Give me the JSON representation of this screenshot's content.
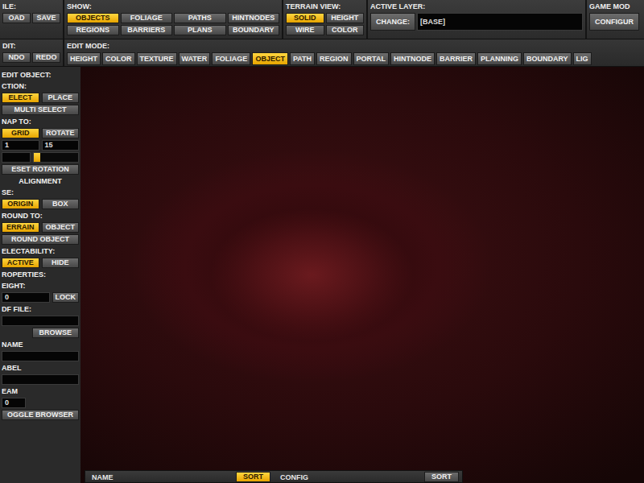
{
  "toolbar": {
    "file": {
      "label": "ILE:",
      "buttons": [
        {
          "label": "OAD",
          "selected": false
        },
        {
          "label": "SAVE",
          "selected": false
        }
      ]
    },
    "show": {
      "label": "SHOW:",
      "buttons": [
        {
          "label": "OBJECTS",
          "selected": true
        },
        {
          "label": "FOLIAGE",
          "selected": false
        },
        {
          "label": "PATHS",
          "selected": false
        },
        {
          "label": "HINTNODES",
          "selected": false
        },
        {
          "label": "REGIONS",
          "selected": false
        },
        {
          "label": "BARRIERS",
          "selected": false
        },
        {
          "label": "PLANS",
          "selected": false
        },
        {
          "label": "BOUNDARY",
          "selected": false
        }
      ]
    },
    "terrain_view": {
      "label": "TERRAIN VIEW:",
      "buttons": [
        {
          "label": "SOLID",
          "selected": true
        },
        {
          "label": "HEIGHT",
          "selected": false
        },
        {
          "label": "WIRE",
          "selected": false
        },
        {
          "label": "COLOR",
          "selected": false
        }
      ]
    },
    "active_layer": {
      "label": "ACTIVE LAYER:",
      "button": "CHANGE:",
      "value": "[BASE]"
    },
    "game_mode": {
      "label": "GAME MOD",
      "button": "CONFIGUR"
    }
  },
  "edit_bar": {
    "edit": {
      "label": "DIT:",
      "buttons": [
        {
          "label": "NDO",
          "selected": false
        },
        {
          "label": "REDO",
          "selected": false
        }
      ]
    },
    "edit_mode": {
      "label": "EDIT MODE:",
      "buttons": [
        {
          "label": "HEIGHT",
          "selected": false
        },
        {
          "label": "COLOR",
          "selected": false
        },
        {
          "label": "TEXTURE",
          "selected": false
        },
        {
          "label": "WATER",
          "selected": false
        },
        {
          "label": "FOLIAGE",
          "selected": false
        },
        {
          "label": "OBJECT",
          "selected": true
        },
        {
          "label": "PATH",
          "selected": false
        },
        {
          "label": "REGION",
          "selected": false
        },
        {
          "label": "PORTAL",
          "selected": false
        },
        {
          "label": "HINTNODE",
          "selected": false
        },
        {
          "label": "BARRIER",
          "selected": false
        },
        {
          "label": "PLANNING",
          "selected": false
        },
        {
          "label": "BOUNDARY",
          "selected": false
        },
        {
          "label": "LIG",
          "selected": false
        }
      ]
    }
  },
  "panel_rows": [
    {
      "kind": "label",
      "text": "EDIT OBJECT:"
    },
    {
      "kind": "label",
      "text": "CTION:"
    },
    {
      "kind": "buttons",
      "buttons": [
        {
          "label": "ELECT",
          "selected": true
        },
        {
          "label": "PLACE",
          "selected": false
        }
      ]
    },
    {
      "kind": "buttons",
      "buttons": [
        {
          "label": "MULTI SELECT",
          "selected": false
        }
      ]
    },
    {
      "kind": "label",
      "text": "NAP TO:"
    },
    {
      "kind": "buttons",
      "buttons": [
        {
          "label": "GRID",
          "selected": true
        },
        {
          "label": "ROTATE",
          "selected": false
        }
      ]
    },
    {
      "kind": "fields",
      "values": [
        "1",
        "15"
      ]
    },
    {
      "kind": "field-slider",
      "value": "",
      "level": 0.0
    },
    {
      "kind": "buttons",
      "buttons": [
        {
          "label": "ESET ROTATION",
          "selected": false
        }
      ]
    },
    {
      "kind": "heading",
      "text": "ALIGNMENT"
    },
    {
      "kind": "label",
      "text": "SE:"
    },
    {
      "kind": "buttons",
      "buttons": [
        {
          "label": "ORIGIN",
          "selected": true
        },
        {
          "label": "BOX",
          "selected": false
        }
      ]
    },
    {
      "kind": "label",
      "text": "ROUND TO:"
    },
    {
      "kind": "buttons",
      "buttons": [
        {
          "label": "ERRAIN",
          "selected": true
        },
        {
          "label": "OBJECT",
          "selected": false
        }
      ]
    },
    {
      "kind": "buttons",
      "buttons": [
        {
          "label": "ROUND OBJECT",
          "selected": false
        }
      ]
    },
    {
      "kind": "label",
      "text": "ELECTABILITY:"
    },
    {
      "kind": "buttons",
      "buttons": [
        {
          "label": "ACTIVE",
          "selected": true
        },
        {
          "label": "HIDE",
          "selected": false
        }
      ]
    },
    {
      "kind": "label",
      "text": "ROPERTIES:"
    },
    {
      "kind": "label",
      "text": "EIGHT:"
    },
    {
      "kind": "field-button",
      "value": "0",
      "button": "LOCK"
    },
    {
      "kind": "label",
      "text": "DF FILE:"
    },
    {
      "kind": "field",
      "value": ""
    },
    {
      "kind": "button-right",
      "button": "BROWSE"
    },
    {
      "kind": "label",
      "text": "NAME"
    },
    {
      "kind": "field",
      "value": ""
    },
    {
      "kind": "label",
      "text": "ABEL"
    },
    {
      "kind": "field",
      "value": ""
    },
    {
      "kind": "label",
      "text": "EAM"
    },
    {
      "kind": "field-small",
      "value": "0"
    },
    {
      "kind": "buttons",
      "buttons": [
        {
          "label": "OGGLE BROWSER",
          "selected": false
        }
      ]
    }
  ],
  "object_list": {
    "columns": [
      {
        "label": "NAME",
        "sort": {
          "label": "SORT",
          "selected": true
        }
      },
      {
        "label": "CONFIG",
        "sort": {
          "label": "SORT",
          "selected": false
        }
      }
    ]
  }
}
